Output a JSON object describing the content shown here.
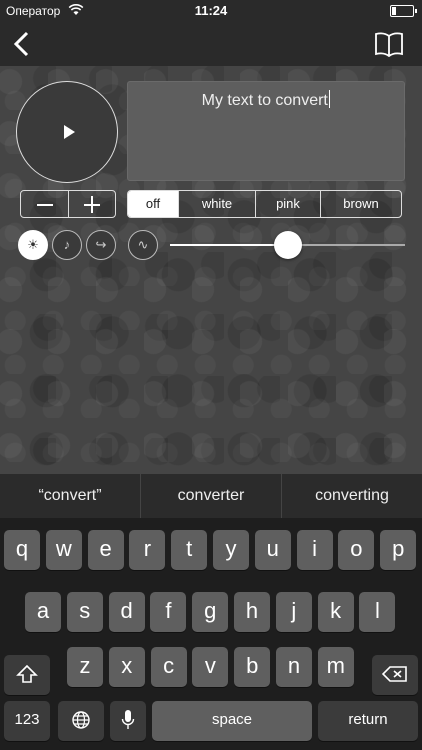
{
  "status": {
    "carrier": "Оператор",
    "time": "11:24"
  },
  "editor": {
    "text": "My text to convert"
  },
  "noise_options": [
    "off",
    "white",
    "pink",
    "brown"
  ],
  "noise_selected": "off",
  "controls": {
    "sun": "☀",
    "note": "♪",
    "repeat": "↪",
    "wave": "∿"
  },
  "slider": {
    "value": 0.5
  },
  "suggestions": [
    "“convert”",
    "converter",
    "converting"
  ],
  "keyboard": {
    "row1": [
      "q",
      "w",
      "e",
      "r",
      "t",
      "y",
      "u",
      "i",
      "o",
      "p"
    ],
    "row2": [
      "a",
      "s",
      "d",
      "f",
      "g",
      "h",
      "j",
      "k",
      "l"
    ],
    "row3": [
      "z",
      "x",
      "c",
      "v",
      "b",
      "n",
      "m"
    ],
    "numbers": "123",
    "space": "space",
    "return": "return"
  }
}
